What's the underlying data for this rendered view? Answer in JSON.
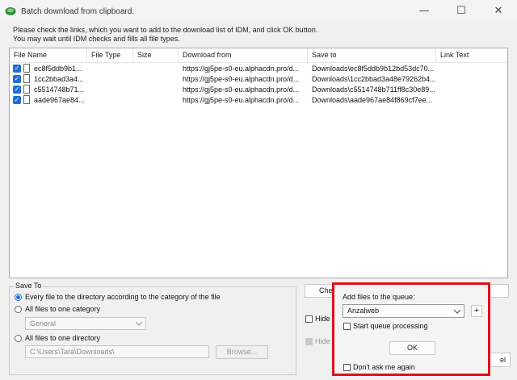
{
  "window": {
    "title": "Batch download from clipboard.",
    "minimize": "—",
    "maximize": "☐",
    "close": "✕"
  },
  "instructions": {
    "line1": "Please check the links, which you want to add to the download list of IDM, and click OK button.",
    "line2": "You may wait until IDM checks and fills all file types."
  },
  "table": {
    "columns": [
      "File Name",
      "File Type",
      "Size",
      "Download from",
      "Save to",
      "Link Text"
    ],
    "rows": [
      {
        "checked": "✓",
        "name": "ec8f5ddb9b1...",
        "type": "",
        "size": "",
        "from": "https://gj5pe-s0-eu.alphacdn.pro/d...",
        "save": "Downloads\\ec8f5ddb9b12bd53dc70...",
        "link": ""
      },
      {
        "checked": "✓",
        "name": "1cc2bbad3a4...",
        "type": "",
        "size": "",
        "from": "https://gj5pe-s0-eu.alphacdn.pro/d...",
        "save": "Downloads\\1cc2bbad3a48e79262b4...",
        "link": ""
      },
      {
        "checked": "✓",
        "name": "c5514748b71...",
        "type": "",
        "size": "",
        "from": "https://gj5pe-s0-eu.alphacdn.pro/d...",
        "save": "Downloads\\c5514748b711ff8c30e89...",
        "link": ""
      },
      {
        "checked": "✓",
        "name": "aade967ae84...",
        "type": "",
        "size": "",
        "from": "https://gj5pe-s0-eu.alphacdn.pro/d...",
        "save": "Downloads\\aade967ae84f869cf7ee...",
        "link": ""
      }
    ]
  },
  "save_to": {
    "group_title": "Save To",
    "option_category": "Every file to the directory according to the category of the file",
    "option_one_category": "All files to one category",
    "category_value": "General",
    "option_one_directory": "All files to one directory",
    "directory_value": "C:\\Users\\Tara\\Downloads\\",
    "browse_label": "Browse..."
  },
  "background": {
    "check_button": "Che",
    "hide1": "Hide",
    "hide2": "Hide",
    "cancel_partial": "el"
  },
  "queue_popup": {
    "label": "Add files to the queue:",
    "queue_value": "Anzalweb",
    "plus": "+",
    "start_processing": "Start queue processing",
    "ok": "OK",
    "dont_ask": "Don't ask me again",
    "highlight_color": "#e0101a"
  }
}
